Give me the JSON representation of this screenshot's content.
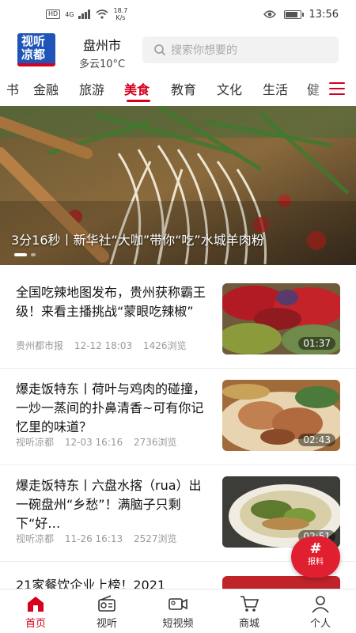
{
  "status_bar": {
    "network_badge": "HD",
    "signal_type": "4G",
    "net_speed_value": "18.7",
    "net_speed_unit": "K/s",
    "time": "13:56",
    "battery_level": 0.9
  },
  "header": {
    "logo_line1": "视听",
    "logo_line2": "凉都",
    "city": "盘州市",
    "weather": "多云10°C",
    "search_placeholder": "搜索你想要的"
  },
  "tabs": [
    {
      "label": "书",
      "active": false
    },
    {
      "label": "金融",
      "active": false
    },
    {
      "label": "旅游",
      "active": false
    },
    {
      "label": "美食",
      "active": true
    },
    {
      "label": "教育",
      "active": false
    },
    {
      "label": "文化",
      "active": false
    },
    {
      "label": "生活",
      "active": false
    },
    {
      "label": "健",
      "active": false
    }
  ],
  "banner": {
    "caption": "3分16秒丨新华社“大咖”带你“吃”水城羊肉粉"
  },
  "news": [
    {
      "title": "全国吃辣地图发布，贵州获称霸王级！来看主播挑战“蒙眼吃辣椒”",
      "source": "贵州都市报",
      "date": "12-12 18:03",
      "views": "1426浏览",
      "duration": "01:37"
    },
    {
      "title": "爆走饭特东丨荷叶与鸡肉的碰撞，一炒一蒸间的扑鼻清香~可有你记忆里的味道？",
      "source": "视听凉都",
      "date": "12-03 16:16",
      "views": "2736浏览",
      "duration": "02:43"
    },
    {
      "title": "爆走饭特东丨六盘水揢（rua）出一碗盘州“乡愁”！满脑子只剩下“好…",
      "source": "视听凉都",
      "date": "11-26 16:13",
      "views": "2527浏览",
      "duration": "02:51"
    },
    {
      "title": "21家餐饮企业上榜！2021",
      "source": "",
      "date": "",
      "views": "",
      "duration": ""
    }
  ],
  "report_fab": {
    "symbol": "#",
    "label": "报料"
  },
  "bottom_nav": [
    {
      "label": "首页",
      "icon": "home-icon",
      "active": true
    },
    {
      "label": "视听",
      "icon": "radio-icon",
      "active": false
    },
    {
      "label": "短视频",
      "icon": "video-camera-icon",
      "active": false
    },
    {
      "label": "商城",
      "icon": "cart-icon",
      "active": false
    },
    {
      "label": "个人",
      "icon": "user-icon",
      "active": false
    }
  ],
  "colors": {
    "accent": "#d6001c",
    "logo_blue": "#1f55b8"
  }
}
